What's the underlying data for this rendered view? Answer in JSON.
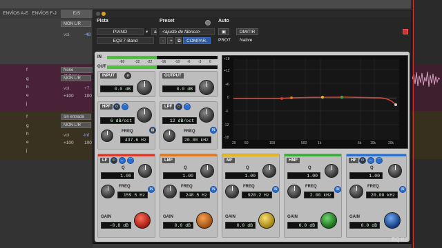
{
  "mixer": {
    "col_sends_ae": "ENVÍOS A-E",
    "col_sends_fj": "ENVÍOS F-J",
    "col_io": "E/S",
    "track1": {
      "io_out": "MON L/R",
      "vol_label": "vol.",
      "vol_value": "-48"
    },
    "track2": {
      "input": "None (2)/None",
      "output": "MON L/R",
      "vol_label": "vol.",
      "vol_value": "+7.",
      "pan": "+100",
      "pan_l": "100",
      "letters": [
        "f",
        "g",
        "h",
        "e",
        "j"
      ]
    },
    "track3": {
      "input": "sin entrada",
      "output": "MON L/R",
      "vol_label": "vol.",
      "vol_value": "-inf",
      "pan": "+100",
      "pan_l": "100",
      "letters": [
        "f",
        "g",
        "h",
        "e",
        "j"
      ]
    }
  },
  "plugin": {
    "pista_label": "Pista",
    "preset_label": "Preset",
    "auto_label": "Auto",
    "track_name": "PIANO",
    "track_slot": "a",
    "insert_name": "EQ3 7-Band",
    "preset_name": "<ajuste de fábrica>",
    "minus_label": "-",
    "plus_label": "+",
    "compare_label": "COMPAR.",
    "omit_label": "OMITIR",
    "prot_label": "PROT",
    "native_label": "Native",
    "in_label": "IN",
    "out_label": "OUT",
    "meter_scale": [
      "-60",
      "-32",
      "-22",
      "-16",
      "-10",
      "-6",
      "-3",
      "0"
    ],
    "in_level": 0.45,
    "out_level": 0.45,
    "input": {
      "title": "INPUT",
      "value": "0.0 dB"
    },
    "output": {
      "title": "OUTPUT",
      "value": "0.0 dB"
    },
    "hpf": {
      "title": "HPF",
      "slope": "6 dB/oct",
      "freq_label": "FREQ",
      "freq": "437.6 Hz"
    },
    "lpf": {
      "title": "LPF",
      "slope": "12 dB/oct",
      "freq_label": "FREQ",
      "freq": "20.00 kHz"
    },
    "graph_y": [
      "+18",
      "+12",
      "+6",
      "0",
      "-6",
      "-12",
      "-18"
    ],
    "graph_x": [
      "20",
      "50",
      "100",
      "500",
      "1k",
      "5k",
      "10k",
      "20k"
    ],
    "bands": [
      {
        "title": "LF",
        "q_label": "Q",
        "q": "1.00",
        "freq_label": "FREQ",
        "freq": "159.5 Hz",
        "gain_label": "GAIN",
        "gain": "-0.8 dB",
        "color": "#d83a2a"
      },
      {
        "title": "LMF",
        "q_label": "Q",
        "q": "1.00",
        "freq_label": "FREQ",
        "freq": "248.5 Hz",
        "gain_label": "GAIN",
        "gain": "0.0 dB",
        "color": "#e07a20"
      },
      {
        "title": "MF",
        "q_label": "Q",
        "q": "1.00",
        "freq_label": "FREQ",
        "freq": "920.2 Hz",
        "gain_label": "GAIN",
        "gain": "0.0 dB",
        "color": "#e8b820"
      },
      {
        "title": "HMF",
        "q_label": "Q",
        "q": "1.00",
        "freq_label": "FREQ",
        "freq": "2.00 kHz",
        "gain_label": "GAIN",
        "gain": "0.0 dB",
        "color": "#3aaa3a"
      },
      {
        "title": "HF",
        "q_label": "Q",
        "q": "1.00",
        "freq_label": "FREQ",
        "freq": "20.00 kHz",
        "gain_label": "GAIN",
        "gain": "0.0 dB",
        "color": "#2a6fcf"
      }
    ],
    "in_btn": "IN",
    "badge": "EQ III"
  }
}
